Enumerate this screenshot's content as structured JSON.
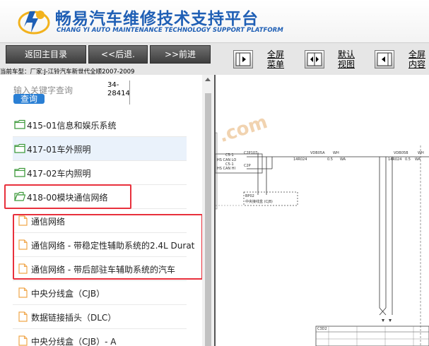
{
  "header": {
    "title_zh": "畅易汽车维修技术支持平台",
    "title_en": "CHANG YI AUTO MAINTENANCE TECHNOLOGY SUPPORT PLATFORM",
    "logo_icon": "cy-logo-icon"
  },
  "toolbar": {
    "back_home": "返回主目录",
    "back": "<<后退.",
    "forward": ">>前进",
    "full_menu": [
      "全屏",
      "菜单"
    ],
    "default_view": [
      "默认",
      "视图"
    ],
    "full_content": [
      "全屏",
      "内容"
    ]
  },
  "vehicle": {
    "label": "当前车型：厂家:J-江铃汽车新世代全顺2007-2009"
  },
  "search": {
    "placeholder": "输入关键字查询",
    "button": "查询",
    "code_line1": "34-",
    "code_line2": "28414"
  },
  "tree": {
    "folders": [
      {
        "label": "415-01信息和娱乐系统"
      },
      {
        "label": "417-01车外照明"
      },
      {
        "label": "417-02车内照明"
      },
      {
        "label": "418-00模块通信网络"
      }
    ],
    "docs": [
      {
        "label": "通信网络"
      },
      {
        "label": "通信网络 - 带稳定性辅助系统的2.4L Durat"
      },
      {
        "label": "通信网络 - 带后部驻车辅助系统的汽车"
      },
      {
        "label": "中央分线盒（CJB）"
      },
      {
        "label": "数据链接插头（DLC）"
      },
      {
        "label": "中央分线盒（CJB）- A"
      }
    ]
  },
  "diagram": {
    "watermark": ".com",
    "labels": {
      "c_top_left": "C2P107",
      "c_mid_left": "C2P",
      "hs_can_lo": "HS CAN LO",
      "hs_can_hi": "HS CAN HI",
      "c51_a": "C5-1",
      "c51_b": "C5-1",
      "bp02": "BP02",
      "cjb": "中央接线盒 (CJB)",
      "vdb05a": "VDB05A",
      "vdb05b": "VDB05B",
      "wh1": "WH",
      "wh2": "WH",
      "wire1": "14R024",
      "wire2": "14R024",
      "v1": "0.5",
      "v2": "0.5",
      "wa1": "WA",
      "wa2": "WA",
      "bottom": "C3D2"
    }
  },
  "colors": {
    "brand_blue": "#1f5fb5",
    "highlight_red": "#e8303c",
    "folder_green": "#3f9a3c",
    "doc_orange": "#f0a64a"
  }
}
